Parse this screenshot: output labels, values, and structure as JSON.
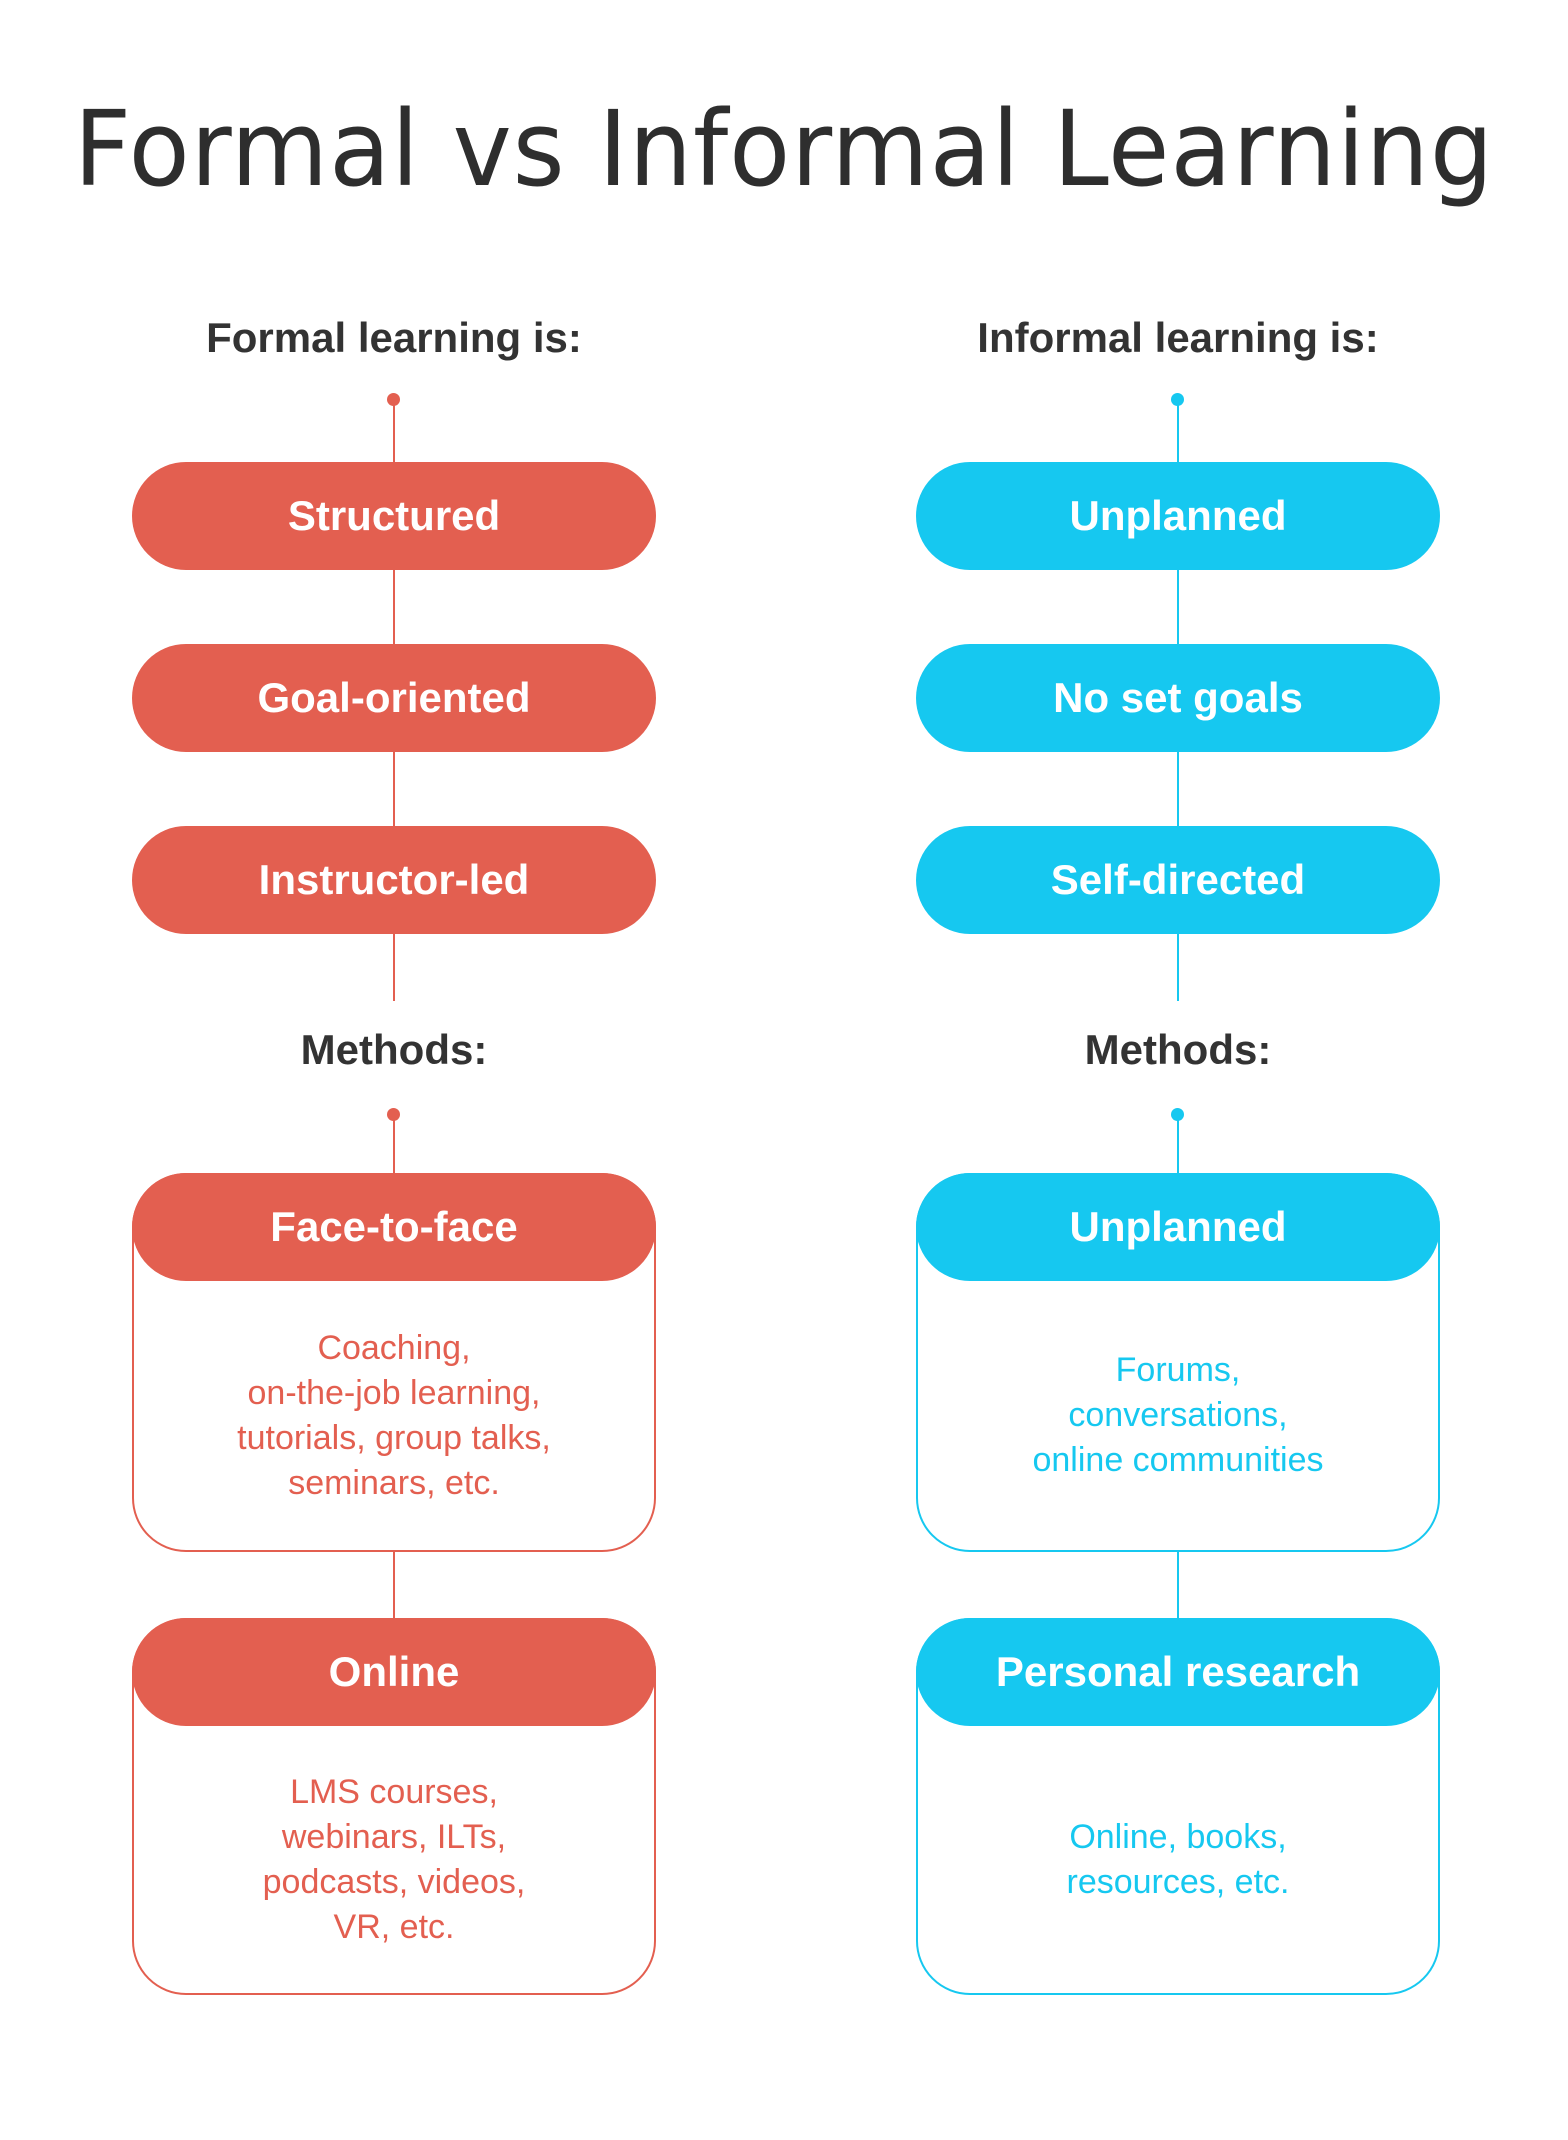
{
  "title": "Formal vs Informal Learning",
  "colors": {
    "formal": "#E35F50",
    "informal": "#16C8F0",
    "text": "#333333"
  },
  "columns": [
    {
      "heading": "Formal learning is:",
      "traits": [
        "Structured",
        "Goal-oriented",
        "Instructor-led"
      ],
      "methods_heading": "Methods:",
      "methods": [
        {
          "title": "Face-to-face",
          "lines": [
            "Coaching,",
            "on-the-job learning,",
            "tutorials, group talks,",
            "seminars, etc."
          ]
        },
        {
          "title": "Online",
          "lines": [
            "LMS courses,",
            "webinars, ILTs,",
            "podcasts, videos,",
            "VR, etc."
          ]
        }
      ]
    },
    {
      "heading": "Informal learning is:",
      "traits": [
        "Unplanned",
        "No set goals",
        "Self-directed"
      ],
      "methods_heading": "Methods:",
      "methods": [
        {
          "title": "Unplanned",
          "lines": [
            "Forums,",
            "conversations,",
            "online communities"
          ]
        },
        {
          "title": "Personal research",
          "lines": [
            "Online, books,",
            "resources, etc."
          ]
        }
      ]
    }
  ]
}
